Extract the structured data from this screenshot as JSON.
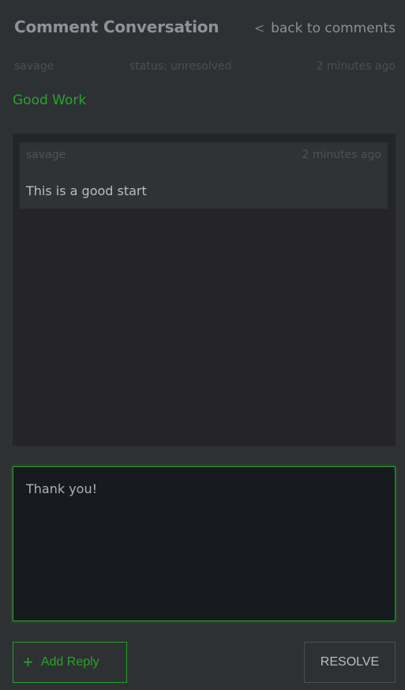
{
  "header": {
    "title": "Comment Conversation",
    "back_icon": "chevron-left-icon",
    "back_label": "back to comments"
  },
  "meta": {
    "user": "savage",
    "status": "status: unresolved",
    "time": "2 minutes ago"
  },
  "subject": "Good Work",
  "thread": {
    "comments": [
      {
        "user": "savage",
        "time": "2 minutes ago",
        "text": "This is a good start"
      }
    ]
  },
  "reply": {
    "value": "Thank you!"
  },
  "actions": {
    "add_reply_icon": "plus-icon",
    "add_reply_label": "Add Reply",
    "resolve_label": "RESOLVE"
  },
  "colors": {
    "accent": "#27a428",
    "background": "#2e3134",
    "thread_background": "#252528"
  }
}
